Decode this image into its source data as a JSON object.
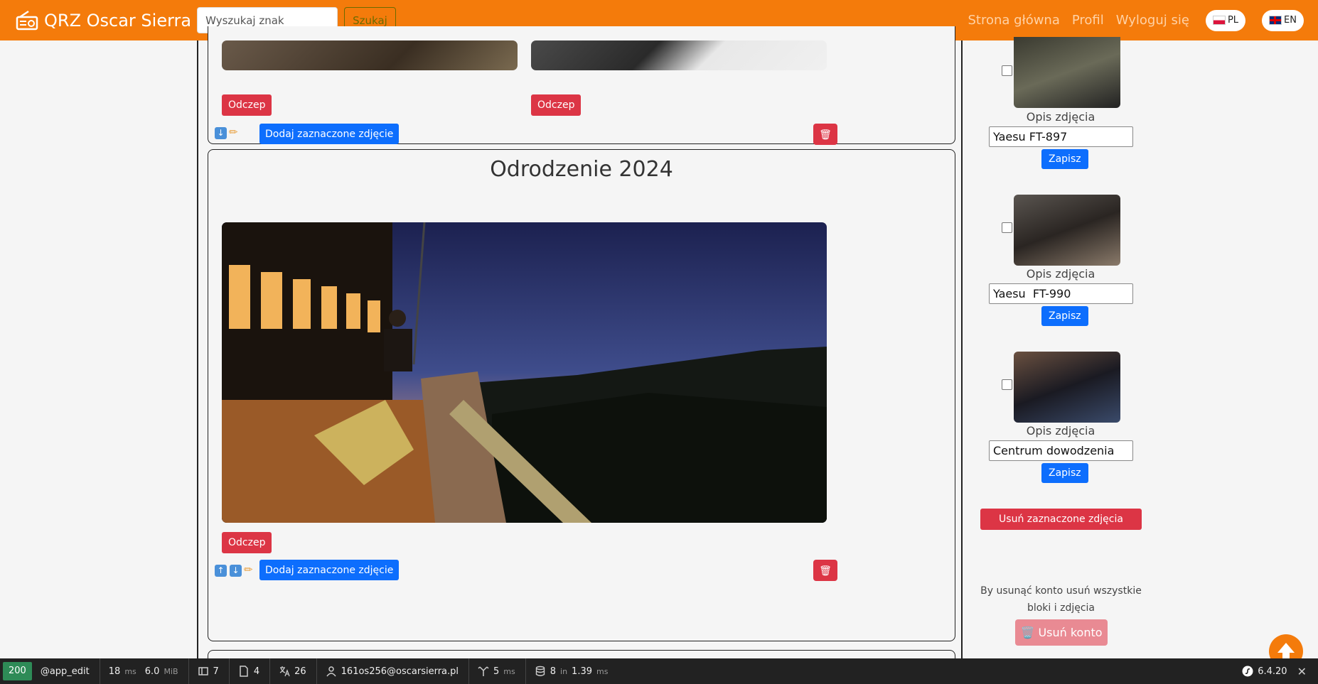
{
  "nav": {
    "brand": "QRZ Oscar Sierra",
    "search_placeholder": "Wyszukaj znak",
    "search_button": "Szukaj",
    "links": [
      "Strona główna",
      "Profil",
      "Wyloguj się"
    ],
    "lang_pl": "PL",
    "lang_en": "EN"
  },
  "blocks": [
    {
      "detach_labels": [
        "Odczep",
        "Odczep"
      ],
      "add_selected": "Dodaj zaznaczone zdjęcie"
    },
    {
      "title": "Odrodzenie 2024",
      "detach_label": "Odczep",
      "add_selected": "Dodaj zaznaczone zdjęcie"
    }
  ],
  "sidebar": {
    "items": [
      {
        "label": "Opis zdjęcia",
        "value": "Yaesu FT-897",
        "save": "Zapisz"
      },
      {
        "label": "Opis zdjęcia",
        "value": "Yaesu  FT-990",
        "save": "Zapisz"
      },
      {
        "label": "Opis zdjęcia",
        "value": "Centrum dowodzenia",
        "save": "Zapisz"
      }
    ],
    "delete_selected": "Usuń zaznaczone zdjęcia",
    "warning": "By usunąć konto usuń wszystkie bloki i zdjęcia",
    "delete_account": "🗑️ Usuń konto"
  },
  "debug": {
    "status": "200",
    "route": "@app_edit",
    "time": "18",
    "time_unit": "ms",
    "memory": "6.0",
    "memory_unit": "MiB",
    "forms": "7",
    "templates": "4",
    "translations": "26",
    "user": "161os256@oscarsierra.pl",
    "events_time": "5",
    "events_unit": "ms",
    "db_queries": "8",
    "db_in": "in",
    "db_time": "1.39",
    "db_unit": "ms",
    "version": "6.4.20"
  }
}
